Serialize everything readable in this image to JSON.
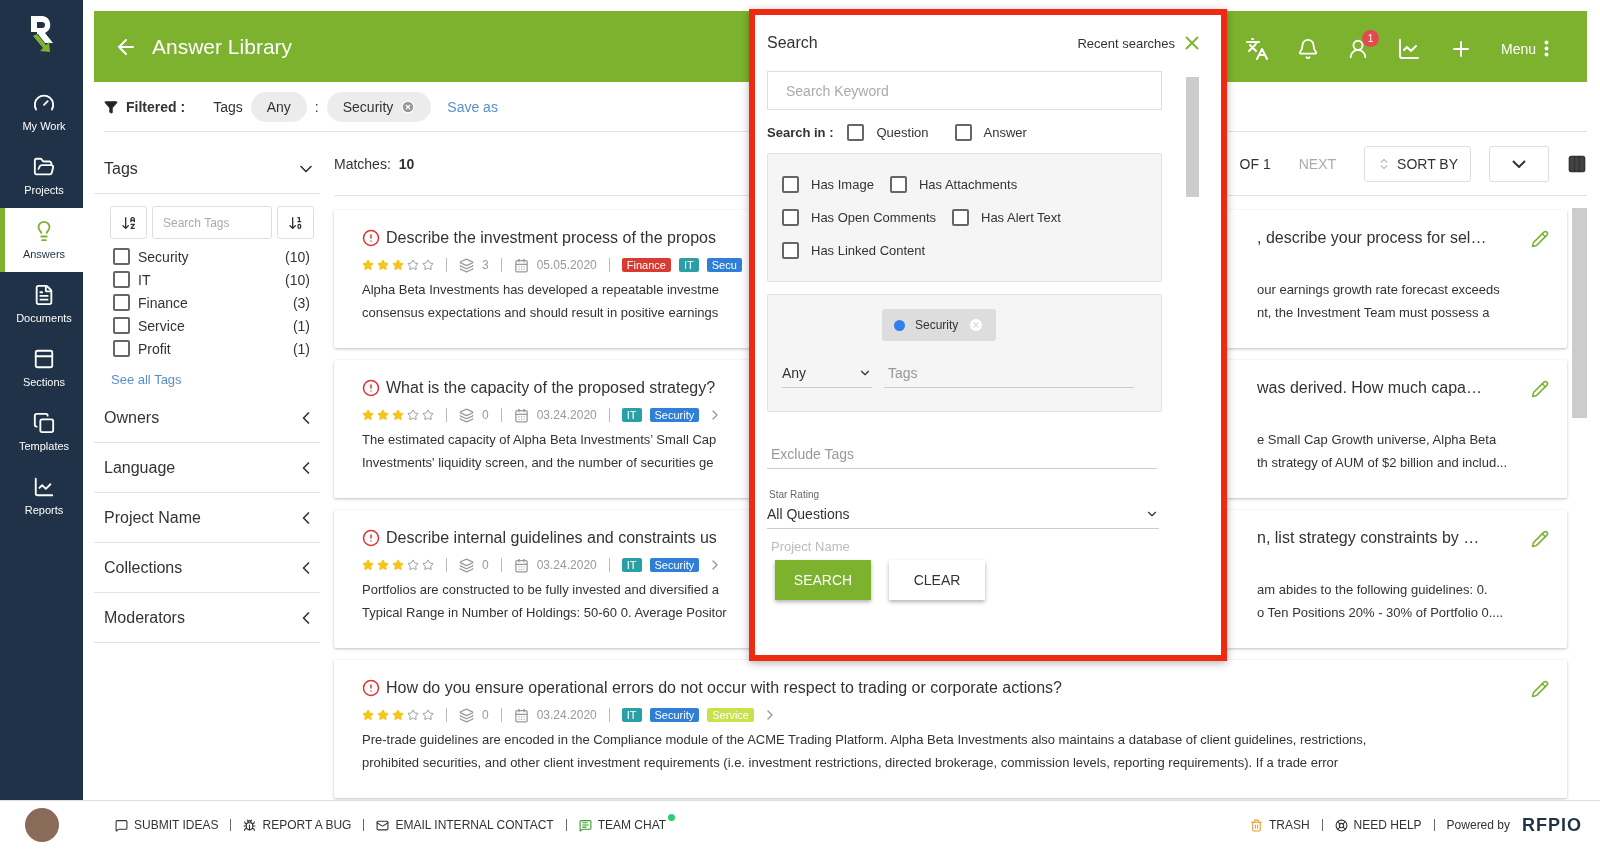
{
  "sidebar": {
    "items": [
      {
        "label": "My Work",
        "kind": "work",
        "selected": false
      },
      {
        "label": "Projects",
        "kind": "projects",
        "selected": false
      },
      {
        "label": "Answers",
        "kind": "answers",
        "selected": true
      },
      {
        "label": "Documents",
        "kind": "documents",
        "selected": false
      },
      {
        "label": "Sections",
        "kind": "sections",
        "selected": false
      },
      {
        "label": "Templates",
        "kind": "templates",
        "selected": false
      },
      {
        "label": "Reports",
        "kind": "reports",
        "selected": false
      }
    ]
  },
  "header": {
    "title": "Answer Library",
    "notification_count": "1",
    "menu_label": "Menu"
  },
  "filter_bar": {
    "label": "Filtered :",
    "field": "Tags",
    "match": "Any",
    "separator": ":",
    "value": "Security",
    "save": "Save as"
  },
  "filters": {
    "tags": {
      "title": "Tags",
      "expanded": true,
      "search_placeholder": "Search Tags",
      "items": [
        {
          "label": "Security",
          "count": "(10)",
          "checked": false
        },
        {
          "label": "IT",
          "count": "(10)",
          "checked": false
        },
        {
          "label": "Finance",
          "count": "(3)",
          "checked": false
        },
        {
          "label": "Service",
          "count": "(1)",
          "checked": false
        },
        {
          "label": "Profit",
          "count": "(1)",
          "checked": false
        }
      ],
      "see_all": "See all Tags"
    },
    "sections": [
      {
        "title": "Owners",
        "expanded": false
      },
      {
        "title": "Language",
        "expanded": false
      },
      {
        "title": "Project Name",
        "expanded": false
      },
      {
        "title": "Collections",
        "expanded": false
      },
      {
        "title": "Moderators",
        "expanded": false
      }
    ]
  },
  "results": {
    "matches_label": "Matches:",
    "matches_count": "10",
    "page": "OF 1",
    "next": "NEXT",
    "sort": "SORT BY"
  },
  "cards": [
    {
      "kind": "split",
      "title_left": "Describe the investment process of the propos",
      "title_right": ", describe your process for sel…",
      "stars": 3,
      "versions": "3",
      "date": "05.05.2020",
      "more": false,
      "tags": [
        {
          "label": "Finance",
          "color": "#d93a32"
        },
        {
          "label": "IT",
          "color": "#2a9fa5"
        },
        {
          "label": "Secu",
          "color": "#2f7fd8"
        }
      ],
      "body": [
        {
          "left": "Alpha Beta Investments has developed a repeatable investme",
          "right": "our earnings growth rate forecast exceeds"
        },
        {
          "left": "consensus expectations and should result in positive earnings",
          "right": "nt, the Investment Team must possess a"
        }
      ]
    },
    {
      "kind": "split",
      "title_left": "What is the capacity of the proposed strategy?",
      "title_right": "was derived. How much capa…",
      "stars": 3,
      "versions": "0",
      "date": "03.24.2020",
      "more": true,
      "tags": [
        {
          "label": "IT",
          "color": "#2a9fa5"
        },
        {
          "label": "Security",
          "color": "#2f7fd8"
        }
      ],
      "body": [
        {
          "left": "The estimated capacity of Alpha Beta Investments’ Small Cap",
          "right": "e Small Cap Growth universe, Alpha Beta"
        },
        {
          "left": "Investments' liquidity screen, and the number of securities ge",
          "right": "th strategy of AUM of $2 billion and includ..."
        }
      ]
    },
    {
      "kind": "split",
      "title_left": "Describe internal guidelines and constraints us",
      "title_right": "n, list strategy constraints by …",
      "stars": 3,
      "versions": "0",
      "date": "03.24.2020",
      "more": true,
      "tags": [
        {
          "label": "IT",
          "color": "#2a9fa5"
        },
        {
          "label": "Security",
          "color": "#2f7fd8"
        }
      ],
      "body": [
        {
          "left": "Portfolios are constructed to be fully invested and diversified a",
          "right": "am abides to the following guidelines: 0."
        },
        {
          "left": "Typical Range in Number of Holdings: 50-60 0. Average Positor",
          "right": "o Ten Positions 20% - 30% of Portfolio 0...."
        }
      ]
    },
    {
      "kind": "full",
      "title_left": "How do you ensure operational errors do not occur with respect to trading or corporate actions?",
      "stars": 3,
      "versions": "0",
      "date": "03.24.2020",
      "more": true,
      "tags": [
        {
          "label": "IT",
          "color": "#2a9fa5"
        },
        {
          "label": "Security",
          "color": "#2f7fd8"
        },
        {
          "label": "Service",
          "color": "#c9e24a"
        }
      ],
      "body": [
        {
          "left": "Pre-trade guidelines are encoded in the Compliance module of the ACME Trading Platform. Alpha Beta Investments also maintains a database of client guidelines, restrictions,"
        },
        {
          "left": "prohibited securities, and other client investment requirements (i.e. investment restrictions, directed brokerage, commission levels, reporting requirements). If a trade error"
        }
      ]
    }
  ],
  "search_panel": {
    "title": "Search",
    "recent": "Recent searches",
    "keyword_placeholder": "Search Keyword",
    "search_in_label": "Search in :",
    "search_in": [
      {
        "label": "Question",
        "checked": false
      },
      {
        "label": "Answer",
        "checked": false
      }
    ],
    "flags": [
      [
        {
          "label": "Has Image",
          "checked": false
        },
        {
          "label": "Has Attachments",
          "checked": false
        }
      ],
      [
        {
          "label": "Has Open Comments",
          "checked": false
        },
        {
          "label": "Has Alert Text",
          "checked": false
        }
      ],
      [
        {
          "label": "Has Linked Content",
          "checked": false
        }
      ]
    ],
    "tag_chips": [
      {
        "label": "Security",
        "color": "#2f80ed"
      }
    ],
    "tag_match": "Any",
    "tags_placeholder": "Tags",
    "exclude_placeholder": "Exclude Tags",
    "star_rating_label": "Star Rating",
    "star_rating_value": "All Questions",
    "project_label": "Project Name",
    "buttons": [
      {
        "label": "SEARCH",
        "kind": "primary"
      },
      {
        "label": "CLEAR",
        "kind": "secondary"
      }
    ]
  },
  "footer": {
    "left": [
      {
        "label": "SUBMIT IDEAS",
        "kind": "ideas",
        "online": false
      },
      {
        "label": "REPORT A BUG",
        "kind": "bug",
        "online": false
      },
      {
        "label": "EMAIL INTERNAL CONTACT",
        "kind": "mail",
        "online": false
      },
      {
        "label": "TEAM CHAT",
        "kind": "chat",
        "online": true
      }
    ],
    "right": [
      {
        "label": "TRASH",
        "kind": "trash"
      },
      {
        "label": "NEED HELP",
        "kind": "help"
      }
    ],
    "powered_by": "Powered by",
    "brand": "RFPIO"
  }
}
